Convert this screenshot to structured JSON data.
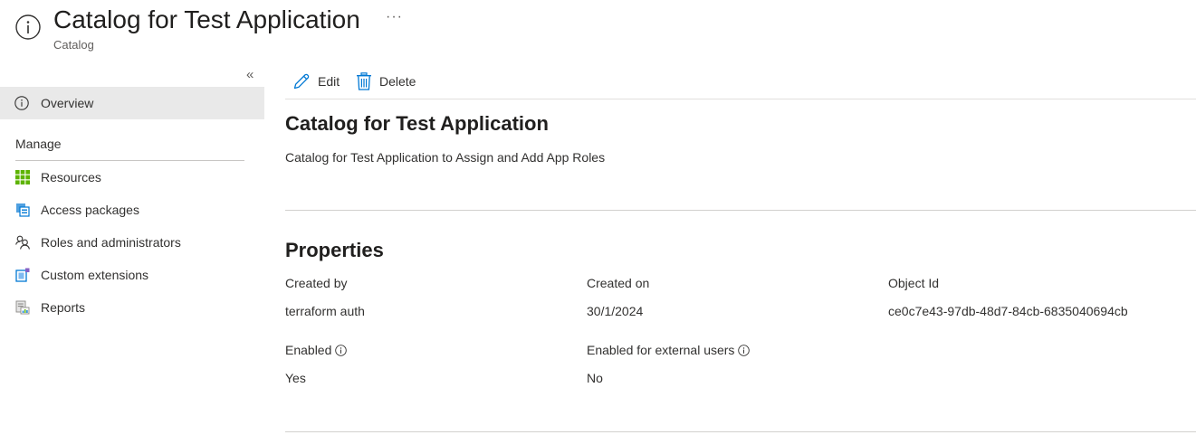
{
  "header": {
    "title": "Catalog for Test Application",
    "subtitle": "Catalog",
    "more": "···"
  },
  "sidebar": {
    "collapse": "«",
    "overview": "Overview",
    "manage_heading": "Manage",
    "items": [
      {
        "label": "Resources",
        "icon": "grid-icon"
      },
      {
        "label": "Access packages",
        "icon": "access-package-icon"
      },
      {
        "label": "Roles and administrators",
        "icon": "people-icon"
      },
      {
        "label": "Custom extensions",
        "icon": "extension-icon"
      },
      {
        "label": "Reports",
        "icon": "report-icon"
      }
    ]
  },
  "toolbar": {
    "edit": "Edit",
    "delete": "Delete"
  },
  "main": {
    "title": "Catalog for Test Application",
    "description": "Catalog for Test Application to Assign and Add App Roles",
    "properties_heading": "Properties",
    "properties": {
      "created_by_label": "Created by",
      "created_by_value": "terraform auth",
      "created_on_label": "Created on",
      "created_on_value": "30/1/2024",
      "object_id_label": "Object Id",
      "object_id_value": "ce0c7e43-97db-48d7-84cb-6835040694cb",
      "enabled_label": "Enabled",
      "enabled_value": "Yes",
      "external_label": "Enabled for external users",
      "external_value": "No"
    }
  },
  "colors": {
    "accent": "#0078d4",
    "green": "#5db300",
    "selected_bg": "#e9e9e9"
  }
}
